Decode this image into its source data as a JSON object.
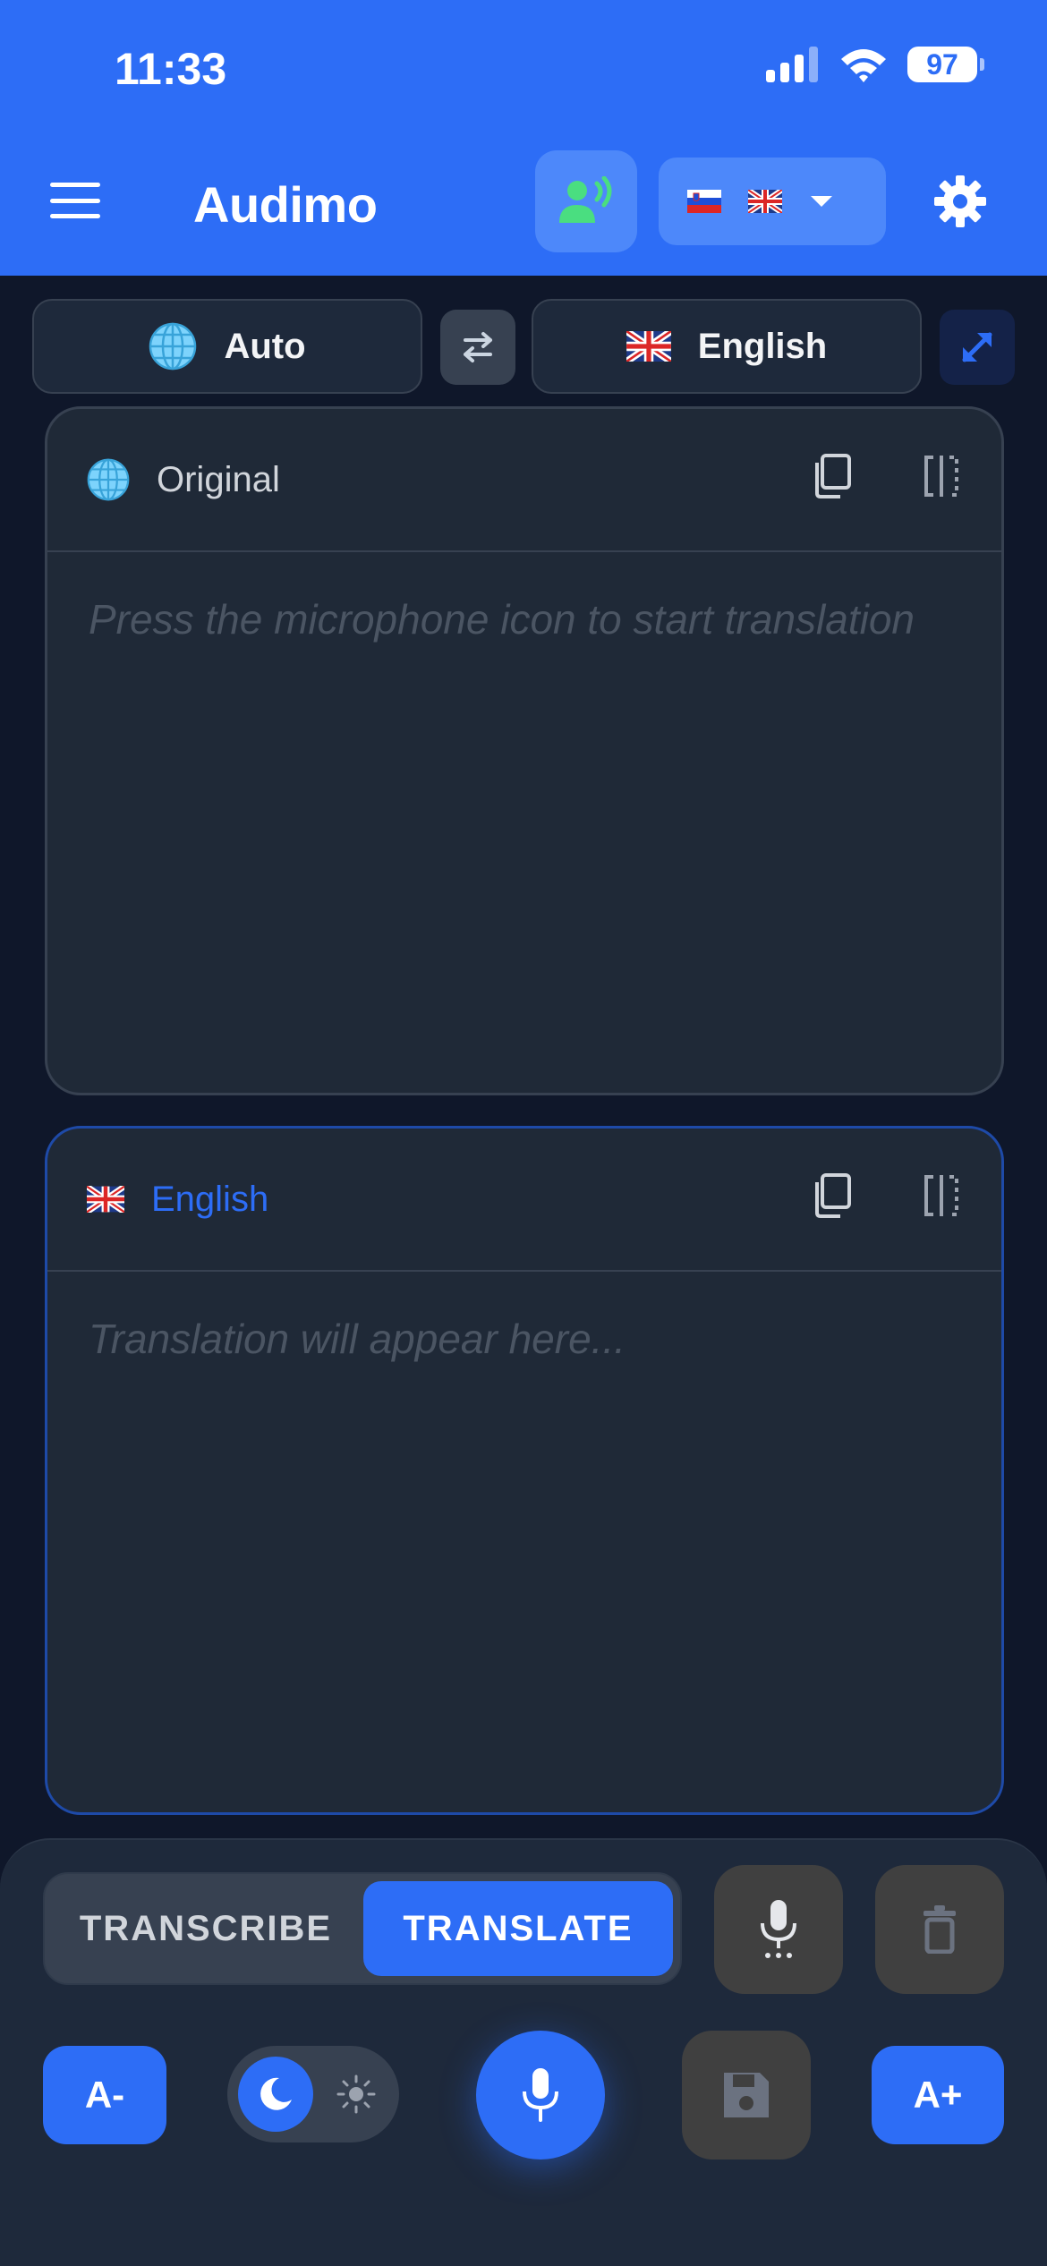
{
  "status_bar": {
    "time": "11:33",
    "battery": "97"
  },
  "header": {
    "title": "Audimo"
  },
  "languages": {
    "source_label": "Auto",
    "target_label": "English"
  },
  "original_panel": {
    "label": "Original",
    "placeholder": "Press the microphone icon to start translation"
  },
  "translation_panel": {
    "label": "English",
    "placeholder": "Translation will appear here..."
  },
  "mode": {
    "options": [
      "TRANSCRIBE",
      "TRANSLATE"
    ],
    "selected": "TRANSLATE"
  },
  "controls": {
    "font_decrease": "A-",
    "font_increase": "A+",
    "theme": "dark"
  },
  "colors": {
    "brand": "#2d6df6",
    "background": "#0f172a",
    "panel": "#1f2937",
    "accent_green": "#4ade80"
  }
}
